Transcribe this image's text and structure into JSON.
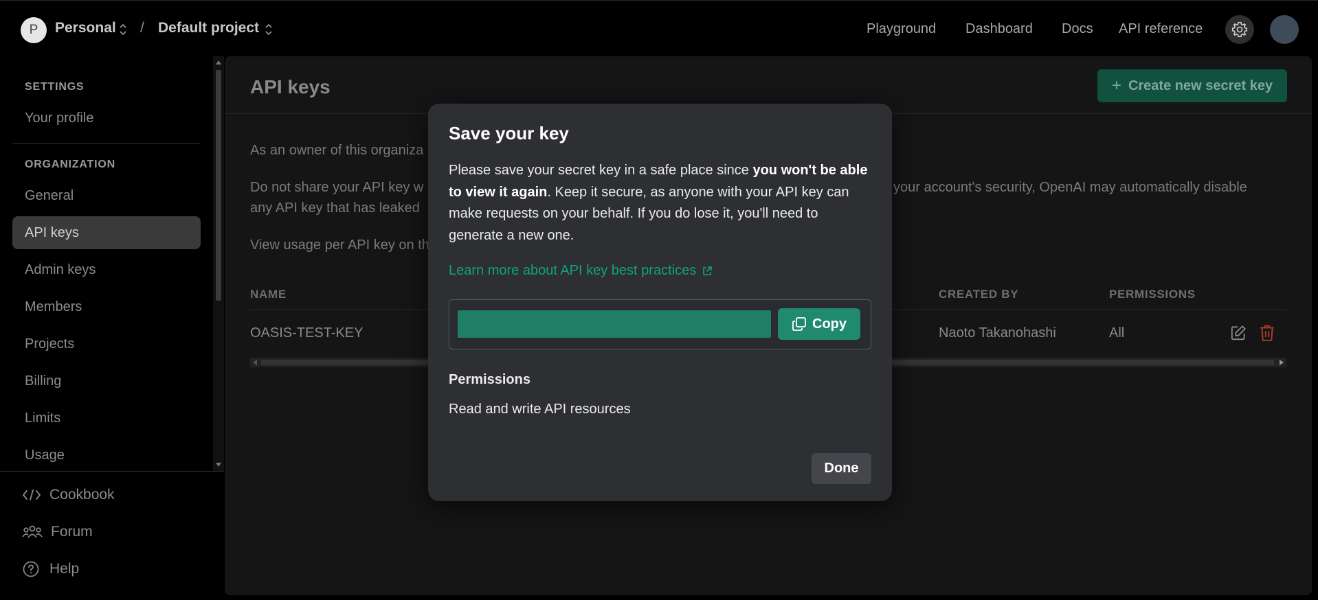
{
  "topbar": {
    "org_initial": "P",
    "org_name": "Personal",
    "separator": "/",
    "project_name": "Default project",
    "links": [
      "Playground",
      "Dashboard",
      "Docs",
      "API reference"
    ]
  },
  "sidebar": {
    "settings_heading": "SETTINGS",
    "profile_label": "Your profile",
    "org_heading": "ORGANIZATION",
    "items": [
      "General",
      "API keys",
      "Admin keys",
      "Members",
      "Projects",
      "Billing",
      "Limits",
      "Usage"
    ],
    "active_item": "API keys",
    "footer": {
      "cookbook": "Cookbook",
      "forum": "Forum",
      "help": "Help"
    }
  },
  "main": {
    "title": "API keys",
    "create_button": "Create new secret key",
    "para1": "As an owner of this organiza",
    "para2_line1": "Do not share your API key w",
    "para2_line1_right": "your account's security, OpenAI may automatically disable",
    "para2_line2": "any API key that has leaked",
    "para3": "View usage per API key on th",
    "table": {
      "headers": [
        "NAME",
        "CREATED BY",
        "PERMISSIONS"
      ],
      "rows": [
        {
          "name": "OASIS-TEST-KEY",
          "created_by": "Naoto Takanohashi",
          "permissions": "All"
        }
      ]
    }
  },
  "modal": {
    "title": "Save your key",
    "body_pre": "Please save your secret key in a safe place since ",
    "body_bold": "you won't be able to view it again",
    "body_post": ". Keep it secure, as anyone with your API key can make requests on your behalf. If you do lose it, you'll need to generate a new one.",
    "link": "Learn more about API key best practices",
    "copy_button": "Copy",
    "permissions_label": "Permissions",
    "permissions_value": "Read and write API resources",
    "done_button": "Done"
  },
  "colors": {
    "accent_green": "#10a37f",
    "key_field": "#1f7f66",
    "danger_red": "#b0392f"
  }
}
